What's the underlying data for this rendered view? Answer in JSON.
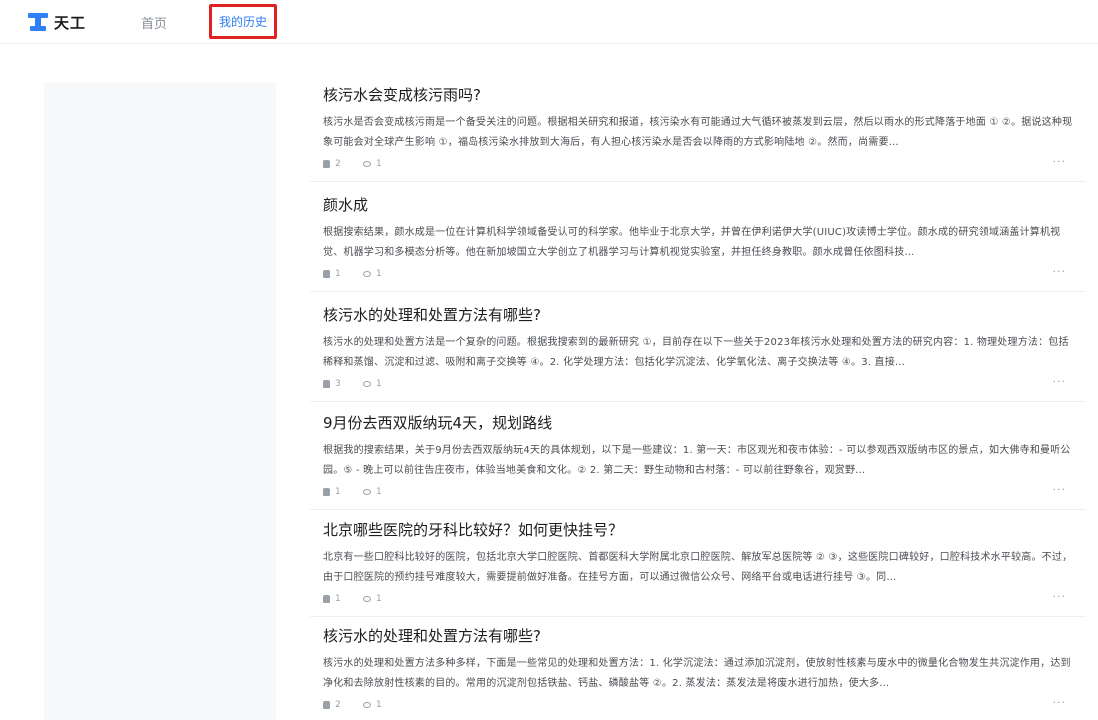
{
  "header": {
    "logo_text": "天工",
    "nav_home": "首页",
    "nav_history": "我的历史"
  },
  "colors": {
    "accent": "#2f7ff5",
    "highlight_box": "#e02222"
  },
  "history": [
    {
      "title": "核污水会变成核污雨吗?",
      "snippet": "核污水是否会变成核污雨是一个备受关注的问题。根据相关研究和报道，核污染水有可能通过大气循环被蒸发到云层，然后以雨水的形式降落于地面 ① ②。据说这种现象可能会对全球产生影响 ①，福岛核污染水排放到大海后，有人担心核污染水是否会以降雨的方式影响陆地 ②。然而，尚需要…",
      "likes": "2",
      "views": "1"
    },
    {
      "title": "颜水成",
      "snippet": "根据搜索结果，颜水成是一位在计算机科学领域备受认可的科学家。他毕业于北京大学，并曾在伊利诺伊大学(UIUC)攻读博士学位。颜水成的研究领域涵盖计算机视觉、机器学习和多模态分析等。他在新加坡国立大学创立了机器学习与计算机视觉实验室，并担任终身教职。颜水成曾任依图科技…",
      "likes": "1",
      "views": "1"
    },
    {
      "title": "核污水的处理和处置方法有哪些?",
      "snippet": "核污水的处理和处置方法是一个复杂的问题。根据我搜索到的最新研究 ①，目前存在以下一些关于2023年核污水处理和处置方法的研究内容：1. 物理处理方法：包括稀释和蒸馏、沉淀和过滤、吸附和离子交换等 ④。2. 化学处理方法：包括化学沉淀法、化学氧化法、离子交换法等 ④。3. 直接…",
      "likes": "3",
      "views": "1"
    },
    {
      "title": "9月份去西双版纳玩4天，规划路线",
      "snippet": "根据我的搜索结果，关于9月份去西双版纳玩4天的具体规划，以下是一些建议：1. 第一天：市区观光和夜市体验：- 可以参观西双版纳市区的景点，如大佛寺和曼听公园。⑤ - 晚上可以前往告庄夜市，体验当地美食和文化。② 2. 第二天：野生动物和古村落：- 可以前往野象谷，观赏野…",
      "likes": "1",
      "views": "1"
    },
    {
      "title": "北京哪些医院的牙科比较好？如何更快挂号？",
      "snippet": "北京有一些口腔科比较好的医院，包括北京大学口腔医院、首都医科大学附属北京口腔医院、解放军总医院等 ② ③，这些医院口碑较好，口腔科技术水平较高。不过，由于口腔医院的预约挂号难度较大，需要提前做好准备。在挂号方面，可以通过微信公众号、网络平台或电话进行挂号 ③。同…",
      "likes": "1",
      "views": "1"
    },
    {
      "title": "核污水的处理和处置方法有哪些?",
      "snippet": "核污水的处理和处置方法多种多样，下面是一些常见的处理和处置方法：1. 化学沉淀法：通过添加沉淀剂，使放射性核素与废水中的微量化合物发生共沉淀作用，达到净化和去除放射性核素的目的。常用的沉淀剂包括铁盐、钙盐、磷酸盐等 ②。2. 蒸发法：蒸发法是将废水进行加热，使大多…",
      "likes": "2",
      "views": "1"
    }
  ]
}
